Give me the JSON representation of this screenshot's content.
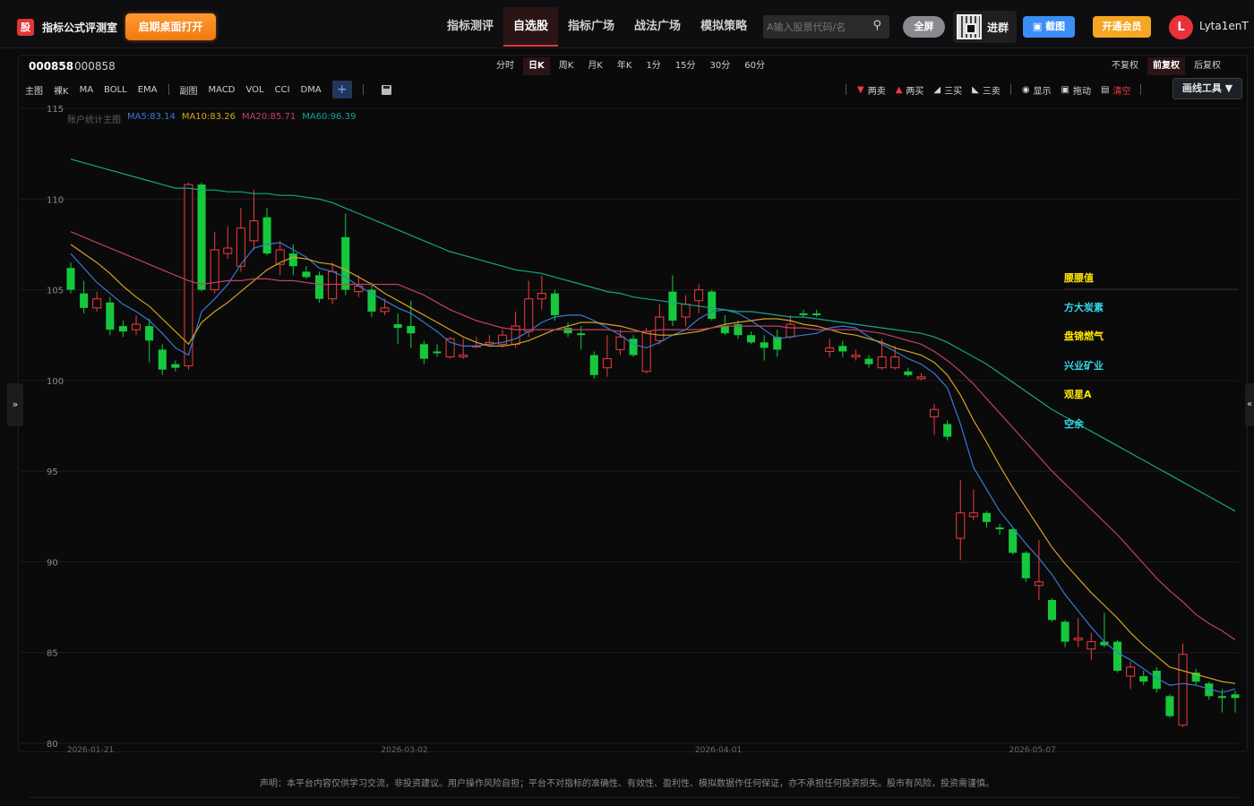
{
  "brand": {
    "logo_char": "股",
    "name": "指标公式评测室",
    "open_desktop": "启期桌面打开"
  },
  "nav": [
    {
      "label": "指标测评",
      "active": false
    },
    {
      "label": "自选股",
      "active": true
    },
    {
      "label": "指标广场",
      "active": false
    },
    {
      "label": "战法广场",
      "active": false
    },
    {
      "label": "模拟策略",
      "active": false
    }
  ],
  "search": {
    "placeholder": "A输入股票代码/名"
  },
  "header_buttons": {
    "fullscreen": "全屏",
    "group": "进群",
    "screenshot": "截图",
    "member": "开通会员"
  },
  "user": {
    "initial": "L",
    "name": "Lyta1enT"
  },
  "stock": {
    "code": "000858",
    "name": "000858"
  },
  "periods": [
    "分时",
    "日K",
    "周K",
    "月K",
    "年K",
    "1分",
    "15分",
    "30分",
    "60分"
  ],
  "active_period": "日K",
  "rights": [
    "不复权",
    "前复权",
    "后复权"
  ],
  "active_right": "前复权",
  "indicators": [
    "主图",
    "裸K",
    "MA",
    "BOLL",
    "EMA",
    "副图",
    "MACD",
    "VOL",
    "CCI",
    "DMA"
  ],
  "add_label": "+",
  "draw_tools": {
    "two_sell": "两卖",
    "two_buy": "两买",
    "three_buy": "三买",
    "three_sell": "三卖",
    "show": "显示",
    "drag": "拖动",
    "clear": "清空",
    "draw_line": "画线工具 ▼"
  },
  "legend": {
    "title": "账户统计主图",
    "ma5": "MA5:83.14",
    "ma10": "MA10:83.26",
    "ma20": "MA20:85.71",
    "ma60": "MA60:96.39"
  },
  "side_labels": [
    {
      "text": "腰腰值",
      "color": "#ffe600"
    },
    {
      "text": "方大炭素",
      "color": "#35d6e8"
    },
    {
      "text": "盘锦燃气",
      "color": "#ffe600"
    },
    {
      "text": "兴业矿业",
      "color": "#35d6e8"
    },
    {
      "text": "观星A",
      "color": "#ffe600"
    },
    {
      "text": "空余",
      "color": "#35d6e8"
    }
  ],
  "toggle_left": "»",
  "toggle_right": "«",
  "disclaimer": "声明：本平台内容仅供学习交流，非投资建议。用户操作风险自担；平台不对指标的准确性、有效性、盈利性、模拟数据作任何保证，亦不承担任何投资损失。股市有风险，投资需谨慎。",
  "colors": {
    "up": "#f23b3b",
    "down": "#16c83c",
    "ma5": "#3a78d0",
    "ma10": "#d6a321",
    "ma20": "#c0406a",
    "ma60": "#14a58a"
  },
  "chart_data": {
    "type": "candlestick",
    "ylim": [
      80,
      115
    ],
    "yticks": [
      80,
      85,
      90,
      95,
      100,
      105,
      110,
      115
    ],
    "xticks": [
      {
        "label": "2026-01-21",
        "index": 0
      },
      {
        "label": "2026-03-02",
        "index": 24
      },
      {
        "label": "2026-04-01",
        "index": 48
      },
      {
        "label": "2026-05-07",
        "index": 72
      }
    ],
    "candles": [
      [
        106.2,
        105.0,
        106.5,
        104.8
      ],
      [
        104.8,
        104.0,
        105.5,
        103.7
      ],
      [
        104.0,
        104.5,
        104.9,
        103.8
      ],
      [
        104.3,
        102.8,
        104.6,
        102.5
      ],
      [
        103.0,
        102.7,
        103.3,
        102.4
      ],
      [
        102.8,
        103.1,
        103.6,
        102.5
      ],
      [
        103.0,
        102.2,
        103.4,
        101.0
      ],
      [
        101.7,
        100.6,
        102.0,
        100.3
      ],
      [
        100.9,
        100.7,
        101.1,
        100.5
      ],
      [
        100.8,
        110.8,
        110.9,
        100.6
      ],
      [
        110.8,
        105.0,
        110.9,
        104.9
      ],
      [
        105.0,
        107.2,
        108.2,
        104.8
      ],
      [
        107.0,
        107.3,
        108.5,
        106.7
      ],
      [
        106.3,
        108.4,
        109.5,
        106.0
      ],
      [
        107.7,
        108.8,
        110.5,
        107.2
      ],
      [
        109.0,
        107.0,
        109.5,
        106.9
      ],
      [
        106.4,
        107.2,
        107.7,
        105.8
      ],
      [
        107.0,
        106.3,
        107.5,
        105.8
      ],
      [
        106.0,
        105.7,
        106.3,
        105.6
      ],
      [
        105.8,
        104.5,
        106.0,
        104.3
      ],
      [
        104.5,
        106.0,
        106.5,
        104.2
      ],
      [
        107.9,
        105.0,
        109.2,
        104.7
      ],
      [
        104.9,
        105.2,
        105.8,
        104.6
      ],
      [
        105.0,
        103.8,
        105.4,
        103.5
      ],
      [
        103.8,
        104.0,
        104.5,
        103.6
      ],
      [
        103.1,
        102.9,
        103.7,
        102.0
      ],
      [
        103.0,
        102.6,
        104.4,
        101.8
      ],
      [
        102.0,
        101.2,
        102.2,
        100.9
      ],
      [
        101.6,
        101.5,
        102.0,
        101.3
      ],
      [
        101.3,
        102.3,
        102.4,
        101.2
      ],
      [
        101.3,
        101.4,
        102.3,
        101.2
      ],
      [
        101.9,
        101.9,
        102.4,
        101.8
      ],
      [
        102.0,
        102.1,
        102.5,
        101.9
      ],
      [
        102.0,
        102.5,
        102.8,
        101.8
      ],
      [
        102.0,
        103.0,
        103.8,
        101.8
      ],
      [
        102.7,
        104.5,
        105.5,
        102.4
      ],
      [
        104.5,
        104.8,
        105.8,
        103.9
      ],
      [
        104.8,
        103.6,
        105.0,
        103.3
      ],
      [
        102.9,
        102.6,
        103.2,
        102.4
      ],
      [
        102.6,
        102.5,
        103.0,
        101.7
      ],
      [
        101.4,
        100.3,
        101.6,
        100.1
      ],
      [
        100.7,
        101.2,
        102.5,
        100.2
      ],
      [
        101.7,
        102.4,
        102.8,
        101.4
      ],
      [
        102.3,
        101.4,
        102.5,
        101.3
      ],
      [
        100.5,
        102.7,
        102.9,
        100.4
      ],
      [
        102.2,
        103.5,
        104.2,
        102.0
      ],
      [
        104.9,
        103.3,
        105.8,
        103.0
      ],
      [
        103.5,
        104.2,
        104.7,
        103.0
      ],
      [
        104.4,
        105.0,
        105.3,
        103.7
      ],
      [
        104.9,
        103.4,
        105.0,
        103.3
      ],
      [
        103.0,
        102.6,
        103.6,
        102.5
      ],
      [
        103.1,
        102.5,
        103.3,
        102.3
      ],
      [
        102.5,
        102.1,
        102.7,
        102.0
      ],
      [
        102.1,
        101.8,
        102.5,
        101.1
      ],
      [
        102.4,
        101.7,
        102.8,
        101.3
      ],
      [
        102.4,
        103.1,
        103.6,
        102.3
      ],
      [
        103.7,
        103.6,
        103.9,
        103.5
      ],
      [
        103.7,
        103.6,
        103.9,
        103.5
      ],
      [
        101.6,
        101.8,
        102.3,
        101.3
      ],
      [
        101.9,
        101.6,
        102.2,
        101.3
      ],
      [
        101.3,
        101.4,
        101.7,
        101.1
      ],
      [
        101.2,
        100.9,
        101.4,
        100.7
      ],
      [
        100.7,
        101.3,
        102.3,
        100.6
      ],
      [
        100.7,
        101.3,
        101.9,
        100.6
      ],
      [
        100.5,
        100.3,
        100.7,
        100.2
      ],
      [
        100.1,
        100.2,
        100.4,
        100.0
      ],
      [
        98.0,
        98.4,
        98.7,
        97.0
      ],
      [
        97.6,
        96.9,
        97.8,
        96.7
      ],
      [
        91.3,
        92.7,
        94.5,
        90.1
      ],
      [
        92.5,
        92.7,
        94.0,
        92.3
      ],
      [
        92.7,
        92.2,
        92.8,
        91.9
      ],
      [
        91.9,
        91.8,
        92.1,
        91.5
      ],
      [
        91.8,
        90.5,
        91.9,
        90.4
      ],
      [
        90.5,
        89.1,
        90.6,
        88.9
      ],
      [
        88.7,
        88.9,
        91.2,
        87.9
      ],
      [
        87.9,
        86.8,
        88.0,
        86.7
      ],
      [
        86.7,
        85.6,
        86.8,
        85.3
      ],
      [
        85.7,
        85.8,
        86.9,
        85.3
      ],
      [
        85.2,
        85.6,
        86.1,
        84.6
      ],
      [
        85.6,
        85.4,
        87.2,
        85.3
      ],
      [
        85.6,
        84.0,
        85.7,
        83.9
      ],
      [
        83.7,
        84.2,
        84.5,
        83.0
      ],
      [
        83.7,
        83.4,
        84.0,
        83.2
      ],
      [
        84.0,
        83.0,
        84.2,
        82.8
      ],
      [
        82.6,
        81.5,
        82.7,
        81.4
      ],
      [
        81.0,
        84.9,
        85.5,
        80.9
      ],
      [
        83.9,
        83.4,
        84.1,
        83.2
      ],
      [
        83.3,
        82.6,
        83.4,
        82.4
      ],
      [
        82.6,
        82.5,
        83.0,
        81.7
      ],
      [
        82.7,
        82.5,
        82.9,
        81.7
      ]
    ],
    "series": [
      {
        "name": "MA5",
        "values": [
          107.0,
          106.2,
          105.4,
          104.8,
          104.2,
          103.8,
          103.3,
          102.6,
          101.8,
          101.4,
          103.8,
          104.5,
          105.3,
          106.4,
          107.3,
          107.5,
          107.6,
          107.2,
          106.8,
          106.2,
          106.0,
          105.7,
          105.2,
          104.8,
          104.4,
          104.0,
          103.7,
          103.2,
          102.7,
          102.1,
          101.9,
          101.9,
          102.0,
          102.1,
          102.3,
          102.7,
          103.2,
          103.5,
          103.6,
          103.6,
          103.3,
          102.9,
          102.5,
          102.0,
          101.8,
          102.1,
          102.5,
          102.8,
          103.4,
          103.8,
          103.9,
          103.7,
          103.3,
          102.8,
          102.3,
          102.4,
          102.5,
          102.6,
          102.9,
          103.0,
          102.9,
          102.4,
          102.0,
          101.6,
          101.2,
          100.9,
          100.4,
          99.6,
          97.6,
          95.2,
          94.0,
          92.8,
          91.9,
          91.0,
          90.2,
          89.3,
          88.2,
          87.3,
          86.4,
          85.6,
          85.0,
          84.6,
          84.1,
          83.6,
          83.2,
          83.3,
          83.2,
          83.0,
          82.8,
          83.0
        ]
      },
      {
        "name": "MA10",
        "values": [
          107.5,
          107.0,
          106.5,
          105.9,
          105.2,
          104.6,
          104.1,
          103.4,
          102.7,
          102.0,
          103.2,
          103.8,
          104.3,
          104.9,
          105.5,
          106.1,
          106.5,
          106.8,
          106.7,
          106.5,
          106.4,
          106.1,
          105.7,
          105.3,
          104.8,
          104.4,
          104.0,
          103.6,
          103.2,
          102.8,
          102.4,
          102.1,
          101.9,
          101.9,
          102.0,
          102.2,
          102.5,
          102.8,
          103.0,
          103.2,
          103.2,
          103.1,
          103.0,
          102.8,
          102.6,
          102.5,
          102.5,
          102.6,
          102.7,
          102.9,
          103.1,
          103.2,
          103.3,
          103.4,
          103.4,
          103.3,
          103.1,
          103.0,
          102.8,
          102.6,
          102.5,
          102.3,
          102.1,
          101.8,
          101.6,
          101.4,
          101.0,
          100.3,
          99.2,
          97.8,
          96.6,
          95.3,
          94.1,
          93.0,
          91.9,
          90.8,
          89.9,
          89.1,
          88.3,
          87.6,
          86.9,
          86.1,
          85.4,
          84.8,
          84.2,
          84.0,
          83.8,
          83.6,
          83.4,
          83.3
        ]
      },
      {
        "name": "MA20",
        "values": [
          108.2,
          107.9,
          107.6,
          107.3,
          107.0,
          106.7,
          106.4,
          106.1,
          105.8,
          105.5,
          105.3,
          105.4,
          105.5,
          105.5,
          105.6,
          105.6,
          105.5,
          105.5,
          105.4,
          105.3,
          105.3,
          105.3,
          105.3,
          105.3,
          105.3,
          105.3,
          105.0,
          104.7,
          104.3,
          103.9,
          103.6,
          103.3,
          103.1,
          102.9,
          102.8,
          102.8,
          102.8,
          102.8,
          102.8,
          102.8,
          102.8,
          102.8,
          102.7,
          102.7,
          102.7,
          102.8,
          102.8,
          102.8,
          102.8,
          102.9,
          103.0,
          103.0,
          103.0,
          103.0,
          103.0,
          102.9,
          102.9,
          102.8,
          102.8,
          102.8,
          102.8,
          102.7,
          102.6,
          102.4,
          102.2,
          102.0,
          101.6,
          101.1,
          100.5,
          99.8,
          99.0,
          98.2,
          97.4,
          96.6,
          95.8,
          95.0,
          94.3,
          93.6,
          92.9,
          92.2,
          91.5,
          90.7,
          89.9,
          89.1,
          88.4,
          87.8,
          87.1,
          86.6,
          86.2,
          85.7
        ]
      },
      {
        "name": "MA60",
        "values": [
          112.2,
          112.0,
          111.8,
          111.6,
          111.4,
          111.2,
          111.0,
          110.8,
          110.6,
          110.6,
          110.5,
          110.5,
          110.4,
          110.4,
          110.3,
          110.3,
          110.2,
          110.2,
          110.1,
          110.0,
          109.8,
          109.5,
          109.2,
          108.9,
          108.6,
          108.3,
          108.0,
          107.7,
          107.4,
          107.1,
          106.9,
          106.7,
          106.5,
          106.3,
          106.1,
          106.0,
          105.9,
          105.7,
          105.5,
          105.3,
          105.1,
          104.9,
          104.8,
          104.6,
          104.5,
          104.4,
          104.3,
          104.2,
          104.1,
          104.0,
          103.9,
          103.8,
          103.8,
          103.7,
          103.6,
          103.5,
          103.5,
          103.4,
          103.3,
          103.2,
          103.1,
          103.0,
          102.9,
          102.8,
          102.7,
          102.6,
          102.4,
          102.1,
          101.7,
          101.3,
          100.9,
          100.4,
          99.9,
          99.4,
          98.9,
          98.4,
          98.0,
          97.6,
          97.2,
          96.8,
          96.4,
          96.0,
          95.6,
          95.2,
          94.8,
          94.4,
          94.0,
          93.6,
          93.2,
          92.8
        ]
      }
    ]
  }
}
